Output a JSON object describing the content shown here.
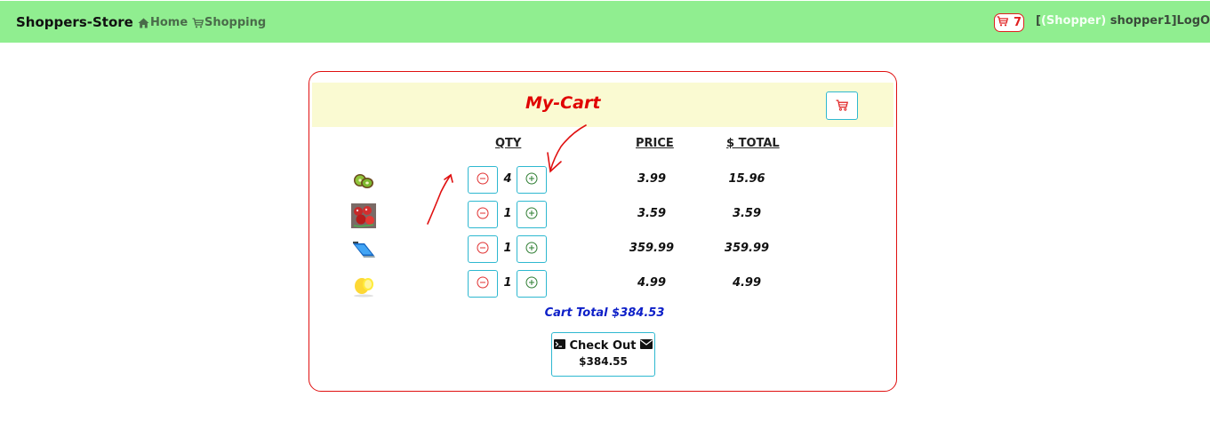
{
  "navbar": {
    "brand": "Shoppers-Store",
    "links": [
      {
        "label": "Home",
        "icon": "home-icon"
      },
      {
        "label": "Shopping",
        "icon": "cart-icon"
      }
    ],
    "cart_count": "7",
    "user_open": "[",
    "user_role": "(Shopper)",
    "user_name": " shopper1]",
    "logout_label": "LogOut"
  },
  "cart": {
    "title": "My-Cart",
    "columns": {
      "qty": "QTY",
      "price": "PRICE",
      "total": "$ TOTAL"
    },
    "items": [
      {
        "image": "kiwi-image",
        "qty": "4",
        "price": "3.99",
        "total": "15.96"
      },
      {
        "image": "tomatoes-image",
        "qty": "1",
        "price": "3.59",
        "total": "3.59"
      },
      {
        "image": "laptop-image",
        "qty": "1",
        "price": "359.99",
        "total": "359.99"
      },
      {
        "image": "lemon-image",
        "qty": "1",
        "price": "4.99",
        "total": "4.99"
      }
    ],
    "cart_total": "Cart Total $384.53",
    "checkout_label": "Check Out",
    "checkout_amount": "$384.55"
  },
  "colors": {
    "navbar_bg": "#90ee90",
    "accent_red": "#e00000",
    "button_border": "#2eb8d0",
    "header_bg": "#fafad2",
    "total_blue": "#0d1fc8"
  }
}
